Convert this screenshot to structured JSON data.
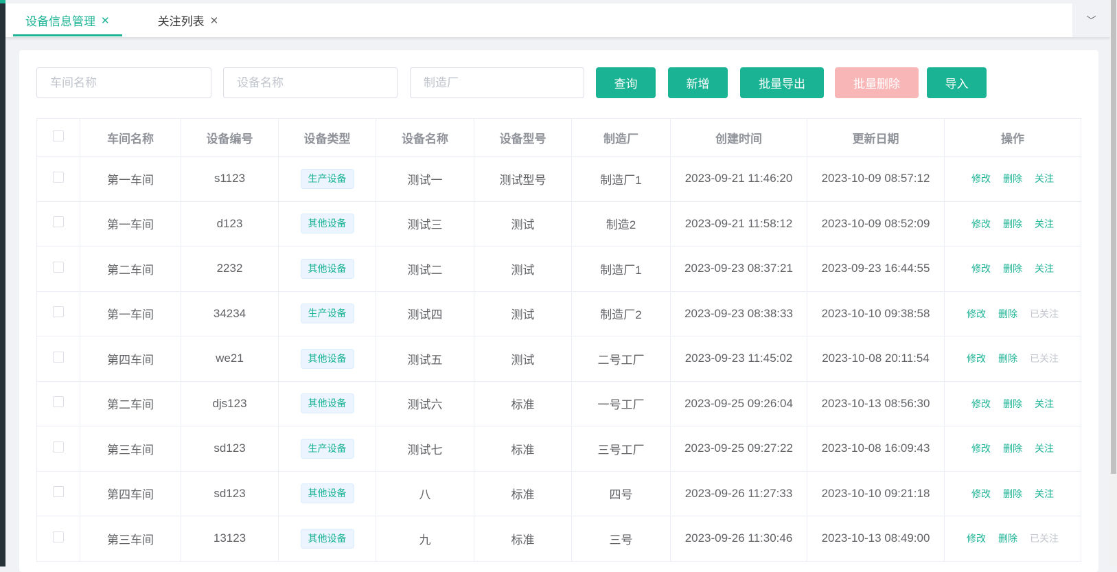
{
  "tabs": [
    {
      "label": "设备信息管理",
      "active": true
    },
    {
      "label": "关注列表",
      "active": false
    }
  ],
  "filters": {
    "workshop_placeholder": "车间名称",
    "device_placeholder": "设备名称",
    "maker_placeholder": "制造厂"
  },
  "buttons": {
    "query": "查询",
    "add": "新增",
    "export": "批量导出",
    "batch_delete": "批量删除",
    "import": "导入"
  },
  "columns": [
    "车间名称",
    "设备编号",
    "设备类型",
    "设备名称",
    "设备型号",
    "制造厂",
    "创建时间",
    "更新日期",
    "操作"
  ],
  "actions": {
    "edit": "修改",
    "delete": "删除",
    "follow": "关注",
    "followed": "已关注"
  },
  "rows": [
    [
      "第一车间",
      "s1123",
      "生产设备",
      "测试一",
      "测试型号",
      "制造厂1",
      "2023-09-21 11:46:20",
      "2023-10-09 08:57:12",
      "关注"
    ],
    [
      "第一车间",
      "d123",
      "其他设备",
      "测试三",
      "测试",
      "制造2",
      "2023-09-21 11:58:12",
      "2023-10-09 08:52:09",
      "关注"
    ],
    [
      "第二车间",
      "2232",
      "其他设备",
      "测试二",
      "测试",
      "制造厂1",
      "2023-09-23 08:37:21",
      "2023-09-23 16:44:55",
      "关注"
    ],
    [
      "第一车间",
      "34234",
      "生产设备",
      "测试四",
      "测试",
      "制造厂2",
      "2023-09-23 08:38:33",
      "2023-10-10 09:38:58",
      "已关注"
    ],
    [
      "第四车间",
      "we21",
      "其他设备",
      "测试五",
      "测试",
      "二号工厂",
      "2023-09-23 11:45:02",
      "2023-10-08 20:11:54",
      "已关注"
    ],
    [
      "第二车间",
      "djs123",
      "其他设备",
      "测试六",
      "标准",
      "一号工厂",
      "2023-09-25 09:26:04",
      "2023-10-13 08:56:30",
      "关注"
    ],
    [
      "第三车间",
      "sd123",
      "生产设备",
      "测试七",
      "标准",
      "三号工厂",
      "2023-09-25 09:27:22",
      "2023-10-08 16:09:43",
      "关注"
    ],
    [
      "第四车间",
      "sd123",
      "其他设备",
      "八",
      "标准",
      "四号",
      "2023-09-26 11:27:33",
      "2023-10-10 09:21:18",
      "关注"
    ],
    [
      "第三车间",
      "13123",
      "其他设备",
      "九",
      "标准",
      "三号",
      "2023-09-26 11:30:46",
      "2023-10-13 08:49:00",
      "已关注"
    ]
  ]
}
